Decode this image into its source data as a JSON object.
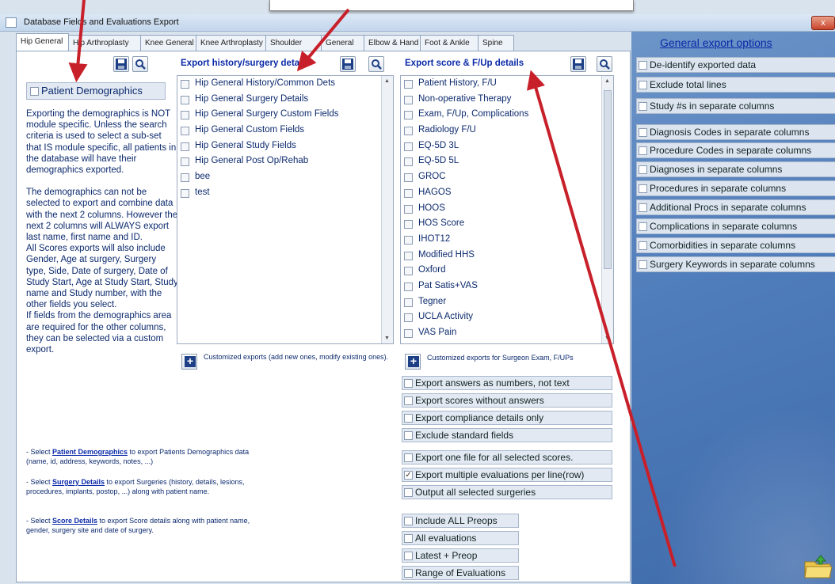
{
  "window": {
    "title": "Database Fields and Evaluations Export",
    "close_label": "x"
  },
  "tabs": [
    {
      "label": "Hip General",
      "active": true
    },
    {
      "label": "Hip Arthroplasty",
      "active": false
    },
    {
      "label": "Knee General",
      "active": false
    },
    {
      "label": "Knee Arthroplasty",
      "active": false
    },
    {
      "label": "Shoulder",
      "active": false
    },
    {
      "label": "General",
      "active": false
    },
    {
      "label": "Elbow & Hand",
      "active": false
    },
    {
      "label": "Foot & Ankle",
      "active": false
    },
    {
      "label": "Spine",
      "active": false
    }
  ],
  "demographics": {
    "checkbox_label": "Patient Demographics",
    "paragraphs": [
      "Exporting the demographics is NOT module specific. Unless the search criteria is used to select a sub-set that IS module specific, all patients in the database will have their demographics exported.",
      "The demographics can not be selected to export and combine data with the next 2 columns. However the next 2 columns will ALWAYS export last name, first name and ID.",
      "All Scores exports will also include Gender, Age at surgery, Surgery type, Side, Date of surgery, Date of Study Start, Age at Study Start, Study name and Study number, with the other fields you select.",
      "If fields from the demographics area are required for the other columns, they can be selected via a custom export."
    ]
  },
  "help": [
    {
      "prefix": "- Select ",
      "link": "Patient Demographics",
      "suffix": " to export Patients Demographics data",
      "line2": "(name, id, address, keywords, notes, ...)"
    },
    {
      "prefix": "- Select ",
      "link": "Surgery Details",
      "suffix": " to export Surgeries (history, details, lesions,",
      "line2": "procedures, implants, postop, ...) along with patient name."
    },
    {
      "prefix": "- Select ",
      "link": "Score Details",
      "suffix": " to export Score details along with patient name,",
      "line2": "gender, surgery site and date of surgery."
    }
  ],
  "history_column": {
    "heading": "Export history/surgery details",
    "items": [
      "Hip General History/Common Dets",
      "Hip General Surgery Details",
      "Hip General Surgery Custom Fields",
      "Hip General Custom Fields",
      "Hip General Study Fields",
      "Hip General Post Op/Rehab",
      "bee",
      "test"
    ],
    "custom_exports_text": "Customized exports (add new ones, modify existing ones)."
  },
  "score_column": {
    "heading": "Export score & F/Up details",
    "items": [
      "Patient History, F/U",
      "Non-operative Therapy",
      "Exam, F/Up, Complications",
      "Radiology F/U",
      "EQ-5D 3L",
      "EQ-5D 5L",
      "GROC",
      "HAGOS",
      "HOOS",
      "HOS Score",
      "IHOT12",
      "Modified HHS",
      "Oxford",
      "Pat Satis+VAS",
      "Tegner",
      "UCLA Activity",
      "VAS Pain"
    ],
    "custom_exports_text": "Customized exports for Surgeon Exam, F/UPs"
  },
  "export_options": [
    {
      "label": "Export answers as numbers, not text",
      "checked": false
    },
    {
      "label": "Export scores without answers",
      "checked": false
    },
    {
      "label": "Export compliance details only",
      "checked": false
    },
    {
      "label": "Exclude standard fields",
      "checked": false
    },
    {
      "label": "Export one file for all selected scores.",
      "checked": false
    },
    {
      "label": "Export multiple evaluations per line(row)",
      "checked": true
    },
    {
      "label": "Output all selected surgeries",
      "checked": false
    }
  ],
  "eval_options": [
    {
      "label": "Include ALL Preops",
      "checked": false
    },
    {
      "label": "All evaluations",
      "checked": false
    },
    {
      "label": "Latest + Preop",
      "checked": false
    },
    {
      "label": "Range of Evaluations",
      "checked": false
    }
  ],
  "general_options": {
    "heading": "General export options",
    "items": [
      "De-identify exported data",
      "Exclude total lines",
      "Study #s in separate columns",
      "Diagnosis Codes in separate columns",
      "Procedure Codes in separate columns",
      "Diagnoses in separate columns",
      "Procedures in separate columns",
      "Additional Procs in separate columns",
      "Complications in separate columns",
      "Comorbidities in separate columns",
      "Surgery Keywords in separate columns"
    ]
  },
  "icons": {
    "save": "save-icon",
    "search": "search-icon",
    "add": "add-icon",
    "folder": "folder-icon"
  },
  "colors": {
    "annotation_arrow": "#c8202a",
    "heading_blue": "#0b2aa8",
    "right_pane": "#4f7cbb"
  }
}
